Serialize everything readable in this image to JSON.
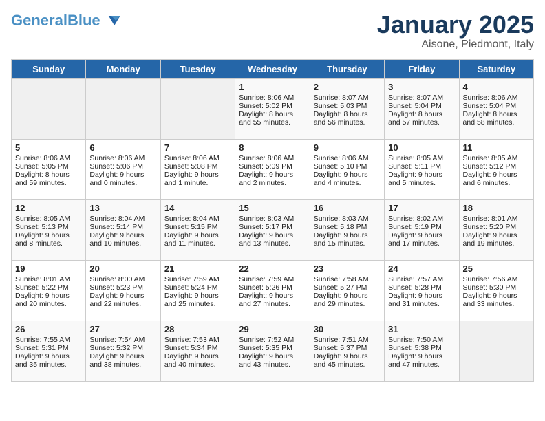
{
  "header": {
    "logo_line1": "General",
    "logo_line2": "Blue",
    "month_title": "January 2025",
    "location": "Aisone, Piedmont, Italy"
  },
  "days_of_week": [
    "Sunday",
    "Monday",
    "Tuesday",
    "Wednesday",
    "Thursday",
    "Friday",
    "Saturday"
  ],
  "weeks": [
    [
      {
        "day": "",
        "empty": true
      },
      {
        "day": "",
        "empty": true
      },
      {
        "day": "",
        "empty": true
      },
      {
        "day": "1",
        "sunrise": "8:06 AM",
        "sunset": "5:02 PM",
        "daylight": "8 hours and 55 minutes."
      },
      {
        "day": "2",
        "sunrise": "8:07 AM",
        "sunset": "5:03 PM",
        "daylight": "8 hours and 56 minutes."
      },
      {
        "day": "3",
        "sunrise": "8:07 AM",
        "sunset": "5:04 PM",
        "daylight": "8 hours and 57 minutes."
      },
      {
        "day": "4",
        "sunrise": "8:06 AM",
        "sunset": "5:04 PM",
        "daylight": "8 hours and 58 minutes."
      }
    ],
    [
      {
        "day": "5",
        "sunrise": "8:06 AM",
        "sunset": "5:05 PM",
        "daylight": "8 hours and 59 minutes."
      },
      {
        "day": "6",
        "sunrise": "8:06 AM",
        "sunset": "5:06 PM",
        "daylight": "9 hours and 0 minutes."
      },
      {
        "day": "7",
        "sunrise": "8:06 AM",
        "sunset": "5:08 PM",
        "daylight": "9 hours and 1 minute."
      },
      {
        "day": "8",
        "sunrise": "8:06 AM",
        "sunset": "5:09 PM",
        "daylight": "9 hours and 2 minutes."
      },
      {
        "day": "9",
        "sunrise": "8:06 AM",
        "sunset": "5:10 PM",
        "daylight": "9 hours and 4 minutes."
      },
      {
        "day": "10",
        "sunrise": "8:05 AM",
        "sunset": "5:11 PM",
        "daylight": "9 hours and 5 minutes."
      },
      {
        "day": "11",
        "sunrise": "8:05 AM",
        "sunset": "5:12 PM",
        "daylight": "9 hours and 6 minutes."
      }
    ],
    [
      {
        "day": "12",
        "sunrise": "8:05 AM",
        "sunset": "5:13 PM",
        "daylight": "9 hours and 8 minutes."
      },
      {
        "day": "13",
        "sunrise": "8:04 AM",
        "sunset": "5:14 PM",
        "daylight": "9 hours and 10 minutes."
      },
      {
        "day": "14",
        "sunrise": "8:04 AM",
        "sunset": "5:15 PM",
        "daylight": "9 hours and 11 minutes."
      },
      {
        "day": "15",
        "sunrise": "8:03 AM",
        "sunset": "5:17 PM",
        "daylight": "9 hours and 13 minutes."
      },
      {
        "day": "16",
        "sunrise": "8:03 AM",
        "sunset": "5:18 PM",
        "daylight": "9 hours and 15 minutes."
      },
      {
        "day": "17",
        "sunrise": "8:02 AM",
        "sunset": "5:19 PM",
        "daylight": "9 hours and 17 minutes."
      },
      {
        "day": "18",
        "sunrise": "8:01 AM",
        "sunset": "5:20 PM",
        "daylight": "9 hours and 19 minutes."
      }
    ],
    [
      {
        "day": "19",
        "sunrise": "8:01 AM",
        "sunset": "5:22 PM",
        "daylight": "9 hours and 20 minutes."
      },
      {
        "day": "20",
        "sunrise": "8:00 AM",
        "sunset": "5:23 PM",
        "daylight": "9 hours and 22 minutes."
      },
      {
        "day": "21",
        "sunrise": "7:59 AM",
        "sunset": "5:24 PM",
        "daylight": "9 hours and 25 minutes."
      },
      {
        "day": "22",
        "sunrise": "7:59 AM",
        "sunset": "5:26 PM",
        "daylight": "9 hours and 27 minutes."
      },
      {
        "day": "23",
        "sunrise": "7:58 AM",
        "sunset": "5:27 PM",
        "daylight": "9 hours and 29 minutes."
      },
      {
        "day": "24",
        "sunrise": "7:57 AM",
        "sunset": "5:28 PM",
        "daylight": "9 hours and 31 minutes."
      },
      {
        "day": "25",
        "sunrise": "7:56 AM",
        "sunset": "5:30 PM",
        "daylight": "9 hours and 33 minutes."
      }
    ],
    [
      {
        "day": "26",
        "sunrise": "7:55 AM",
        "sunset": "5:31 PM",
        "daylight": "9 hours and 35 minutes."
      },
      {
        "day": "27",
        "sunrise": "7:54 AM",
        "sunset": "5:32 PM",
        "daylight": "9 hours and 38 minutes."
      },
      {
        "day": "28",
        "sunrise": "7:53 AM",
        "sunset": "5:34 PM",
        "daylight": "9 hours and 40 minutes."
      },
      {
        "day": "29",
        "sunrise": "7:52 AM",
        "sunset": "5:35 PM",
        "daylight": "9 hours and 43 minutes."
      },
      {
        "day": "30",
        "sunrise": "7:51 AM",
        "sunset": "5:37 PM",
        "daylight": "9 hours and 45 minutes."
      },
      {
        "day": "31",
        "sunrise": "7:50 AM",
        "sunset": "5:38 PM",
        "daylight": "9 hours and 47 minutes."
      },
      {
        "day": "",
        "empty": true
      }
    ]
  ]
}
